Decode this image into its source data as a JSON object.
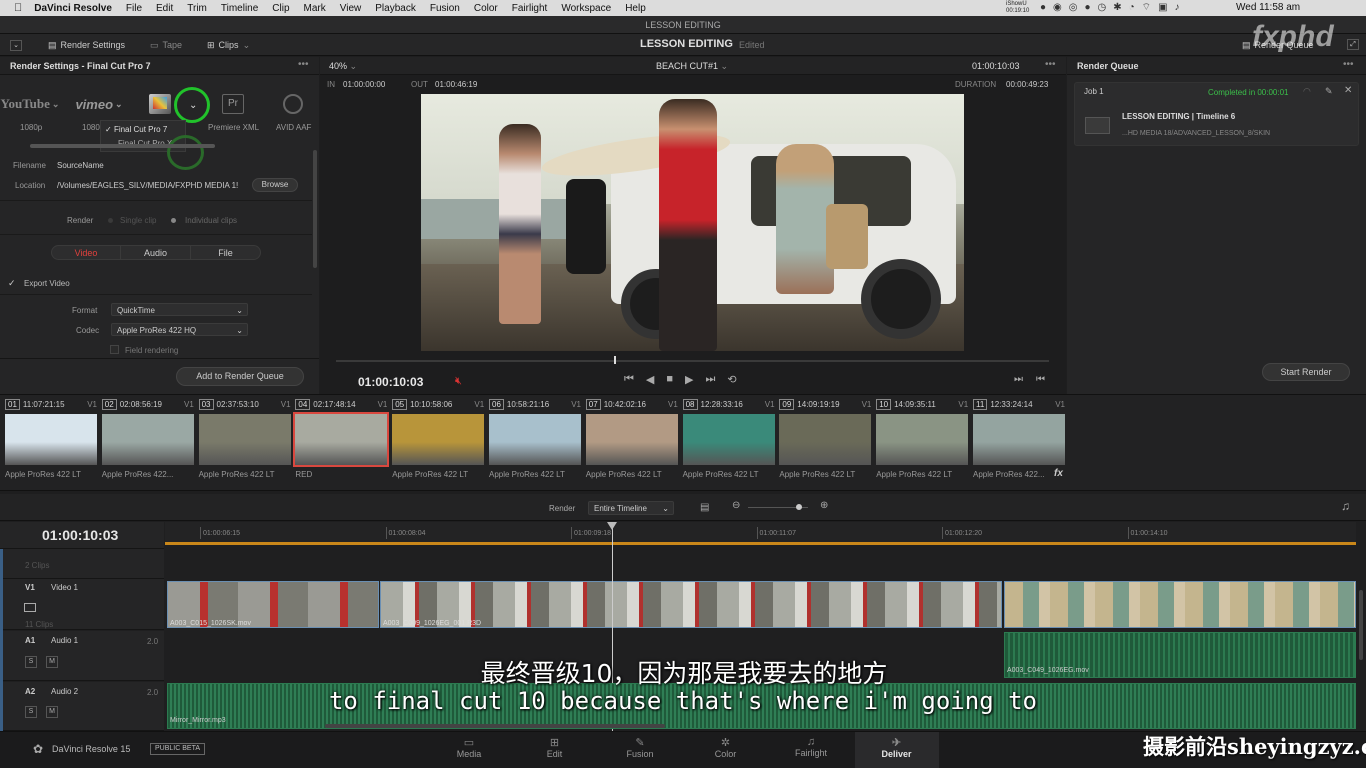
{
  "menubar": {
    "items": [
      "DaVinci Resolve",
      "File",
      "Edit",
      "Trim",
      "Timeline",
      "Clip",
      "Mark",
      "View",
      "Playback",
      "Fusion",
      "Color",
      "Fairlight",
      "Workspace",
      "Help"
    ],
    "clock": "Wed 11:58 am",
    "ishowu": "iShowU",
    "ishowu_time": "00:19:10"
  },
  "window_title": "LESSON EDITING",
  "toolbar": {
    "render_settings": "Render Settings",
    "tape": "Tape",
    "clips": "Clips",
    "project_name": "LESSON EDITING",
    "project_status": "Edited",
    "render_queue": "Render Queue"
  },
  "render_settings": {
    "title": "Render Settings - Final Cut Pro 7",
    "presets": [
      {
        "name": "1080p",
        "icon": "youtube-icon",
        "brand": "YouTube"
      },
      {
        "name": "1080",
        "icon": "vimeo-icon",
        "brand": "vimeo"
      },
      {
        "name": "Final Cut Pro",
        "icon": "final-cut-icon",
        "brand": ""
      },
      {
        "name": "Premiere XML",
        "icon": "premiere-icon",
        "brand": "Pr"
      },
      {
        "name": "AVID AAF",
        "icon": "avid-icon",
        "brand": ""
      }
    ],
    "dropdown_options": [
      "Final Cut Pro 7",
      "Final Cut Pro X"
    ],
    "filename_label": "Filename",
    "filename_value": "SourceName",
    "location_label": "Location",
    "location_value": "/Volumes/EAGLES_SILV/MEDIA/FXPHD MEDIA 1!",
    "browse": "Browse",
    "render_label": "Render",
    "single_clip": "Single clip",
    "individual_clips": "Individual clips",
    "tabs": [
      "Video",
      "Audio",
      "File"
    ],
    "export_video": "Export Video",
    "format_label": "Format",
    "format_value": "QuickTime",
    "codec_label": "Codec",
    "codec_value": "Apple ProRes 422 HQ",
    "field_rendering": "Field rendering",
    "add_to_queue": "Add to Render Queue"
  },
  "viewer": {
    "zoom": "40%",
    "timeline_name": "BEACH CUT#1",
    "timecode_top": "01:00:10:03",
    "in_label": "IN",
    "in_value": "01:00:00:00",
    "out_label": "OUT",
    "out_value": "01:00:46:19",
    "duration_label": "DURATION",
    "duration_value": "00:00:49:23",
    "current_tc": "01:00:10:03",
    "playhead_fraction": 0.39
  },
  "render_queue": {
    "title": "Render Queue",
    "job": "Job 1",
    "status": "Completed in 00:00:01",
    "job_title": "LESSON EDITING | Timeline 6",
    "job_path": "...HD MEDIA 18/ADVANCED_LESSON_8/SKIN",
    "start_render": "Start Render"
  },
  "clips": [
    {
      "num": "01",
      "tc": "11:07:21:15",
      "track": "V1",
      "label": "Apple ProRes 422 LT",
      "color": "#d8e4ec"
    },
    {
      "num": "02",
      "tc": "02:08:56:19",
      "track": "V1",
      "label": "Apple ProRes 422...",
      "color": "#9aa8a4"
    },
    {
      "num": "03",
      "tc": "02:37:53:10",
      "track": "V1",
      "label": "Apple ProRes 422 LT",
      "color": "#7a7a6a"
    },
    {
      "num": "04",
      "tc": "02:17:48:14",
      "track": "V1",
      "label": "RED",
      "color": "#a8aaa0"
    },
    {
      "num": "05",
      "tc": "10:10:58:06",
      "track": "V1",
      "label": "Apple ProRes 422 LT",
      "color": "#b8953a"
    },
    {
      "num": "06",
      "tc": "10:58:21:16",
      "track": "V1",
      "label": "Apple ProRes 422 LT",
      "color": "#a8c0cc"
    },
    {
      "num": "07",
      "tc": "10:42:02:16",
      "track": "V1",
      "label": "Apple ProRes 422 LT",
      "color": "#b29a84"
    },
    {
      "num": "08",
      "tc": "12:28:33:16",
      "track": "V1",
      "label": "Apple ProRes 422 LT",
      "color": "#3a8a7a"
    },
    {
      "num": "09",
      "tc": "14:09:19:19",
      "track": "V1",
      "label": "Apple ProRes 422 LT",
      "color": "#6a6a58"
    },
    {
      "num": "10",
      "tc": "14:09:35:11",
      "track": "V1",
      "label": "Apple ProRes 422 LT",
      "color": "#8a9484"
    },
    {
      "num": "11",
      "tc": "12:33:24:14",
      "track": "V1",
      "label": "Apple ProRes 422...",
      "color": "#94a4a0"
    }
  ],
  "timeline_toolbar": {
    "render_label": "Render",
    "render_value": "Entire Timeline"
  },
  "timeline": {
    "timecode": "01:00:10:03",
    "ruler": [
      "01:00:06:15",
      "01:00:08:04",
      "01:00:09:18",
      "01:00:11:07",
      "01:00:12:20",
      "01:00:14:10"
    ],
    "clips_count_top": "2 Clips",
    "v1_id": "V1",
    "v1_name": "Video 1",
    "v1_clips": "11 Clips",
    "a1_id": "A1",
    "a1_name": "Audio 1",
    "a1_level": "2.0",
    "a2_id": "A2",
    "a2_name": "Audio 2",
    "a2_level": "2.0",
    "video_clip_names": [
      "A003_C015_1026SK.mov",
      "A003_C009_1026EG_001.R3D",
      ""
    ],
    "audio_clip_a1": "A003_C049_1026EG.mov",
    "audio_clip_a2": "Mirror_Mirror.mp3"
  },
  "app": {
    "name": "DaVinci Resolve 15",
    "badge": "PUBLIC BETA"
  },
  "pages": [
    {
      "name": "Media",
      "icon": "media-icon",
      "glyph": "▭"
    },
    {
      "name": "Edit",
      "icon": "edit-icon",
      "glyph": "⊞"
    },
    {
      "name": "Fusion",
      "icon": "fusion-icon",
      "glyph": "✎"
    },
    {
      "name": "Color",
      "icon": "color-icon",
      "glyph": "✲"
    },
    {
      "name": "Fairlight",
      "icon": "fairlight-icon",
      "glyph": "♫"
    },
    {
      "name": "Deliver",
      "icon": "deliver-icon",
      "glyph": "✈"
    }
  ],
  "subtitles": {
    "zh": "最终晋级10，因为那是我要去的地方",
    "en": "to final cut 10 because that's where i'm going to"
  },
  "watermarks": {
    "fxphd": "fxphd",
    "site": "摄影前沿sheyingzyz.com"
  }
}
